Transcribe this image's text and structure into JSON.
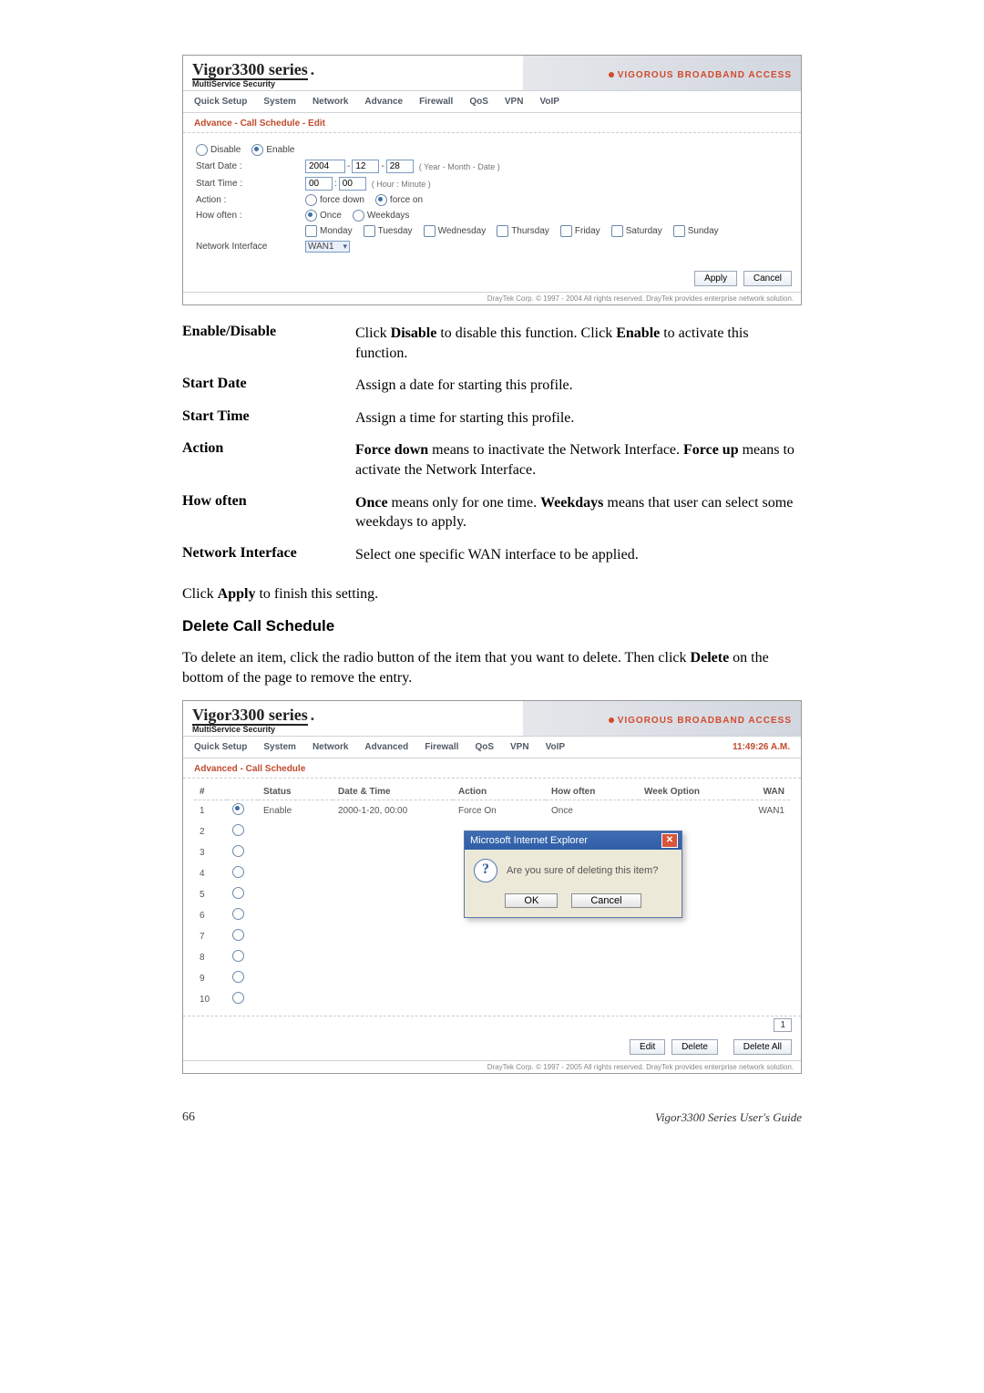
{
  "router": {
    "logoMain": "Vigor3300 series",
    "logoSub": "MultiService Security",
    "tagline": "VIGOROUS BROADBAND ACCESS",
    "menu1": [
      "Quick Setup",
      "System",
      "Network",
      "Advance",
      "Firewall",
      "QoS",
      "VPN",
      "VoIP"
    ],
    "section1": "Advance - Call Schedule - Edit",
    "copyright": "DrayTek Corp. © 1997 - 2004 All rights reserved. DrayTek provides enterprise network solution."
  },
  "form": {
    "disableLabel": "Disable",
    "enableLabel": "Enable",
    "startDateLabel": "Start Date :",
    "year": "2004",
    "month": "12",
    "day": "28",
    "dateHint": "( Year - Month - Date )",
    "startTimeLabel": "Start Time :",
    "hour": "00",
    "minute": "00",
    "timeHint": "( Hour : Minute )",
    "actionLabel": "Action :",
    "actForceDown": "force down",
    "actForceOn": "force on",
    "howOftenLabel": "How often :",
    "howOnce": "Once",
    "howWeekdays": "Weekdays",
    "days": [
      "Monday",
      "Tuesday",
      "Wednesday",
      "Thursday",
      "Friday",
      "Saturday",
      "Sunday"
    ],
    "netIfLabel": "Network Interface",
    "netIfVal": "WAN1",
    "applyBtn": "Apply",
    "cancelBtn": "Cancel"
  },
  "defs": {
    "enableTerm": "Enable/Disable",
    "enableDesc1": "Click ",
    "enableDesc2": "Disable",
    "enableDesc3": " to disable this function. Click ",
    "enableDesc4": "Enable",
    "enableDesc5": " to activate this function.",
    "startDateTerm": "Start Date",
    "startDateDesc": "Assign a date for starting this profile.",
    "startTimeTerm": "Start Time",
    "startTimeDesc": "Assign a time for starting this profile.",
    "actionTerm": "Action",
    "actionDesc1": "Force down",
    "actionDesc2": " means to inactivate the Network Interface. ",
    "actionDesc3": "Force up",
    "actionDesc4": " means to activate the Network Interface.",
    "howTerm": "How often",
    "howDesc1": "Once",
    "howDesc2": " means only for one time. ",
    "howDesc3": "Weekdays",
    "howDesc4": " means that user can select some weekdays to apply.",
    "niTerm": "Network Interface",
    "niDesc": "Select one specific WAN interface to be applied."
  },
  "para1a": "Click ",
  "para1b": "Apply",
  "para1c": " to finish this setting.",
  "h3": "Delete Call Schedule",
  "para2a": "To delete an item, click the radio button of the item that you want to delete. Then click ",
  "para2b": "Delete",
  "para2c": " on the bottom of the page to remove the entry.",
  "shot2": {
    "menu": [
      "Quick Setup",
      "System",
      "Network",
      "Advanced",
      "Firewall",
      "QoS",
      "VPN",
      "VoIP"
    ],
    "clock": "11:49:26 A.M.",
    "section": "Advanced - Call Schedule",
    "headers": {
      "num": "#",
      "status": "Status",
      "datetime": "Date & Time",
      "action": "Action",
      "howoften": "How often",
      "weekopt": "Week Option",
      "wan": "WAN"
    },
    "row1": {
      "num": "1",
      "status": "Enable",
      "datetime": "2000-1-20, 00:00",
      "action": "Force On",
      "howoften": "Once",
      "weekopt": "",
      "wan": "WAN1"
    },
    "rownums": [
      "2",
      "3",
      "4",
      "5",
      "6",
      "7",
      "8",
      "9",
      "10"
    ],
    "pageNum": "1",
    "editBtn": "Edit",
    "deleteBtn": "Delete",
    "deleteAllBtn": "Delete All",
    "copyright": "DrayTek Corp. © 1997 - 2005 All rights reserved. DrayTek provides enterprise network solution."
  },
  "dialog": {
    "title": "Microsoft Internet Explorer",
    "msg": "Are you sure of deleting this item?",
    "ok": "OK",
    "cancel": "Cancel"
  },
  "footer": {
    "pagenum": "66",
    "guide": "Vigor3300 Series User's Guide"
  }
}
